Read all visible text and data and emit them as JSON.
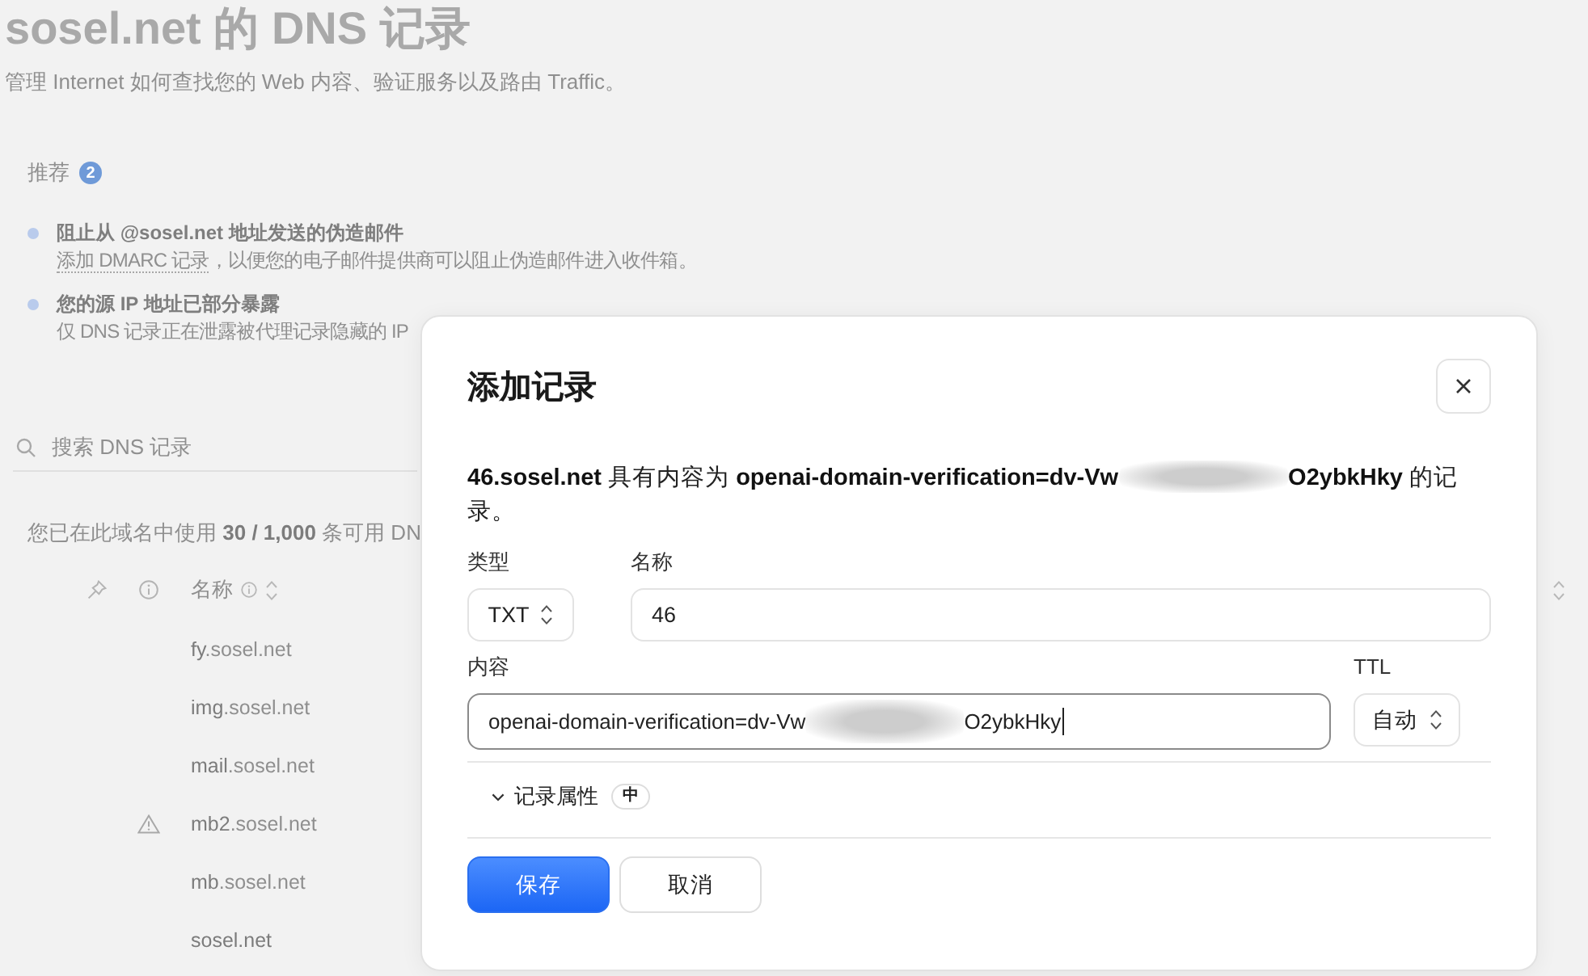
{
  "page": {
    "title": "sosel.net 的 DNS 记录",
    "subtitle": "管理 Internet 如何查找您的 Web 内容、验证服务以及路由 Traffic。"
  },
  "recommendations": {
    "heading": "推荐",
    "count": "2",
    "items": [
      {
        "title": "阻止从 @sosel.net 地址发送的伪造邮件",
        "link": "添加 DMARC 记录",
        "description": "，以便您的电子邮件提供商可以阻止伪造邮件进入收件箱。"
      },
      {
        "title": "您的源 IP 地址已部分暴露",
        "description": "仅 DNS 记录正在泄露被代理记录隐藏的 IP"
      }
    ]
  },
  "search": {
    "placeholder": "搜索 DNS 记录"
  },
  "usage": "您已在此域名中使用 **30 / 1,000** 条可用 DN",
  "table": {
    "name_header": "名称",
    "rows": [
      {
        "name": "fy",
        "zone": ".sosel.net",
        "warning": false
      },
      {
        "name": "img",
        "zone": ".sosel.net",
        "warning": false
      },
      {
        "name": "mail",
        "zone": ".sosel.net",
        "warning": false
      },
      {
        "name": "mb2",
        "zone": ".sosel.net",
        "warning": true
      },
      {
        "name": "mb",
        "zone": ".sosel.net",
        "warning": false
      },
      {
        "name": "sosel.net",
        "warning": false
      }
    ]
  },
  "dialog": {
    "title": "添加记录",
    "summary_start": "**46.sosel.net** 具有内容为 **openai-domain-verification=dv-Vw**",
    "summary_end": "**O2ybkHky** 的记录。",
    "redacted": true,
    "fields": [
      {
        "kind": "select",
        "label": "类型",
        "value": "TXT",
        "focused": false
      },
      {
        "kind": "input",
        "label": "名称",
        "value": "46",
        "focused": false
      },
      {
        "kind": "content",
        "label": "内容",
        "value_start": "openai-domain-verification=dv-Vw",
        "value_end": "O2ybkHky",
        "redacted": true,
        "focused": true
      },
      {
        "kind": "select",
        "label": "TTL",
        "value": "自动",
        "focused": false
      }
    ],
    "attributes": {
      "label": "记录属性",
      "badge": "中"
    },
    "buttons": [
      {
        "kind": "primary",
        "label": "保存"
      },
      {
        "kind": "secondary",
        "label": "取消"
      }
    ]
  }
}
